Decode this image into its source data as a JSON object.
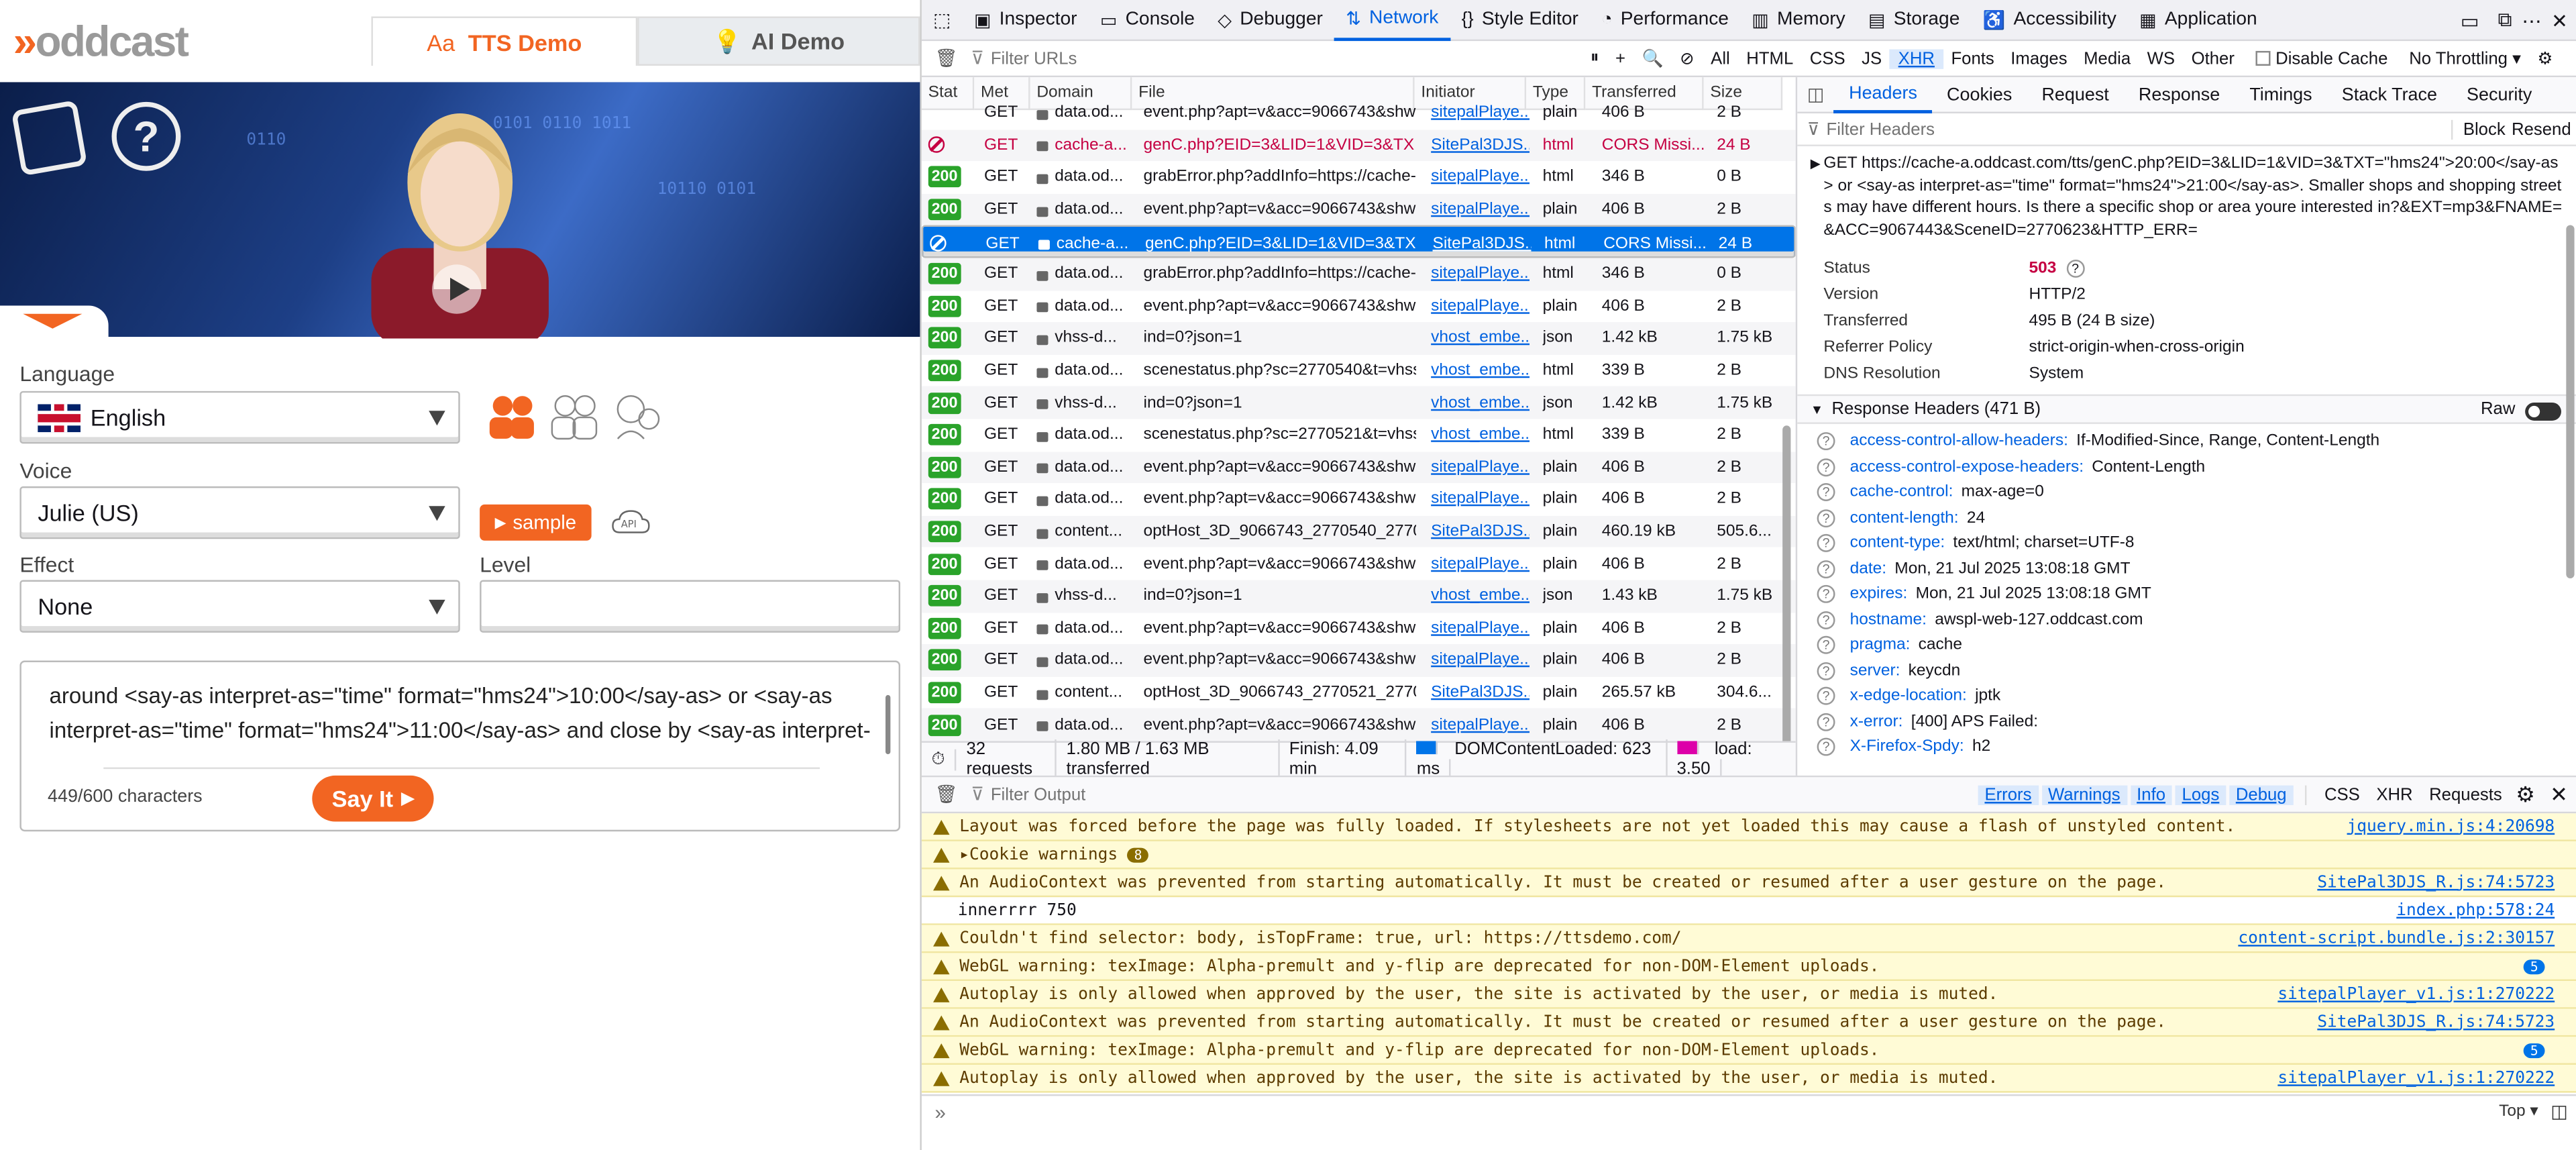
{
  "left": {
    "logo": "oddcast",
    "tabs": {
      "tts": "TTS Demo",
      "ai": "AI Demo"
    },
    "language_label": "Language",
    "language_value": "English",
    "voice_label": "Voice",
    "voice_value": "Julie (US)",
    "sample_label": "sample",
    "effect_label": "Effect",
    "effect_value": "None",
    "level_label": "Level",
    "textarea_text": "around <say-as interpret-as=\"time\" format=\"hms24\">10:00</say-as> or <say-as interpret-as=\"time\" format=\"hms24\">11:00</say-as> and close by <say-as interpret-",
    "char_count": "449/600 characters",
    "sayit_label": "Say It"
  },
  "devtools": {
    "tools": [
      "Inspector",
      "Console",
      "Debugger",
      "Network",
      "Style Editor",
      "Performance",
      "Memory",
      "Storage",
      "Accessibility",
      "Application"
    ],
    "active_tool": "Network",
    "filter_placeholder": "Filter URLs",
    "filter_types": [
      "All",
      "HTML",
      "CSS",
      "JS",
      "XHR",
      "Fonts",
      "Images",
      "Media",
      "WS",
      "Other"
    ],
    "active_filter": "XHR",
    "disable_cache": "Disable Cache",
    "throttle": "No Throttling",
    "columns": [
      "Stat",
      "Met",
      "Domain",
      "File",
      "Initiator",
      "Type",
      "Transferred",
      "Size"
    ],
    "requests": [
      {
        "status": "",
        "method": "GET",
        "domain": "data.od...",
        "file": "event.php?apt=v&acc=9066743&shw=2",
        "initiator": "sitepalPlaye...",
        "type": "plain",
        "transferred": "406 B",
        "size": "2 B",
        "kind": "ok",
        "partial": true
      },
      {
        "status": "",
        "method": "GET",
        "domain": "cache-a...",
        "file": "genC.php?EID=3&LID=1&VID=3&TX",
        "initiator": "SitePal3DJS...",
        "type": "html",
        "transferred": "CORS Missi...",
        "size": "24 B",
        "kind": "err"
      },
      {
        "status": "200",
        "method": "GET",
        "domain": "data.od...",
        "file": "grabError.php?addInfo=https://cache-a",
        "initiator": "sitepalPlaye...",
        "type": "html",
        "transferred": "346 B",
        "size": "0 B",
        "kind": "ok"
      },
      {
        "status": "200",
        "method": "GET",
        "domain": "data.od...",
        "file": "event.php?apt=v&acc=9066743&shw=2",
        "initiator": "sitepalPlaye...",
        "type": "plain",
        "transferred": "406 B",
        "size": "2 B",
        "kind": "ok"
      },
      {
        "status": "",
        "method": "GET",
        "domain": "cache-a...",
        "file": "genC.php?EID=3&LID=1&VID=3&TX",
        "initiator": "SitePal3DJS...",
        "type": "html",
        "transferred": "CORS Missi...",
        "size": "24 B",
        "kind": "sel"
      },
      {
        "status": "200",
        "method": "GET",
        "domain": "data.od...",
        "file": "grabError.php?addInfo=https://cache-a",
        "initiator": "sitepalPlaye...",
        "type": "html",
        "transferred": "346 B",
        "size": "0 B",
        "kind": "ok"
      },
      {
        "status": "200",
        "method": "GET",
        "domain": "data.od...",
        "file": "event.php?apt=v&acc=9066743&shw=2",
        "initiator": "sitepalPlaye...",
        "type": "plain",
        "transferred": "406 B",
        "size": "2 B",
        "kind": "ok"
      },
      {
        "status": "200",
        "method": "GET",
        "domain": "vhss-d...",
        "file": "ind=0?json=1",
        "initiator": "vhost_embe...",
        "type": "json",
        "transferred": "1.42 kB",
        "size": "1.75 kB",
        "kind": "ok"
      },
      {
        "status": "200",
        "method": "GET",
        "domain": "data.od...",
        "file": "scenestatus.php?sc=2770540&t=vhss&",
        "initiator": "vhost_embe...",
        "type": "html",
        "transferred": "339 B",
        "size": "2 B",
        "kind": "ok"
      },
      {
        "status": "200",
        "method": "GET",
        "domain": "vhss-d...",
        "file": "ind=0?json=1",
        "initiator": "vhost_embe...",
        "type": "json",
        "transferred": "1.42 kB",
        "size": "1.75 kB",
        "kind": "ok"
      },
      {
        "status": "200",
        "method": "GET",
        "domain": "data.od...",
        "file": "scenestatus.php?sc=2770521&t=vhss&",
        "initiator": "vhost_embe...",
        "type": "html",
        "transferred": "339 B",
        "size": "2 B",
        "kind": "ok"
      },
      {
        "status": "200",
        "method": "GET",
        "domain": "data.od...",
        "file": "event.php?apt=v&acc=9066743&shw=2",
        "initiator": "sitepalPlaye...",
        "type": "plain",
        "transferred": "406 B",
        "size": "2 B",
        "kind": "ok"
      },
      {
        "status": "200",
        "method": "GET",
        "domain": "data.od...",
        "file": "event.php?apt=v&acc=9066743&shw=2",
        "initiator": "sitepalPlaye...",
        "type": "plain",
        "transferred": "406 B",
        "size": "2 B",
        "kind": "ok"
      },
      {
        "status": "200",
        "method": "GET",
        "domain": "content...",
        "file": "optHost_3D_9066743_2770540_27705",
        "initiator": "SitePal3DJS...",
        "type": "plain",
        "transferred": "460.19 kB",
        "size": "505.6...",
        "kind": "ok"
      },
      {
        "status": "200",
        "method": "GET",
        "domain": "data.od...",
        "file": "event.php?apt=v&acc=9066743&shw=2",
        "initiator": "sitepalPlaye...",
        "type": "plain",
        "transferred": "406 B",
        "size": "2 B",
        "kind": "ok"
      },
      {
        "status": "200",
        "method": "GET",
        "domain": "vhss-d...",
        "file": "ind=0?json=1",
        "initiator": "vhost_embe...",
        "type": "json",
        "transferred": "1.43 kB",
        "size": "1.75 kB",
        "kind": "ok"
      },
      {
        "status": "200",
        "method": "GET",
        "domain": "data.od...",
        "file": "event.php?apt=v&acc=9066743&shw=2",
        "initiator": "sitepalPlaye...",
        "type": "plain",
        "transferred": "406 B",
        "size": "2 B",
        "kind": "ok"
      },
      {
        "status": "200",
        "method": "GET",
        "domain": "data.od...",
        "file": "event.php?apt=v&acc=9066743&shw=2",
        "initiator": "sitepalPlaye...",
        "type": "plain",
        "transferred": "406 B",
        "size": "2 B",
        "kind": "ok"
      },
      {
        "status": "200",
        "method": "GET",
        "domain": "content...",
        "file": "optHost_3D_9066743_2770521_27705",
        "initiator": "SitePal3DJS...",
        "type": "plain",
        "transferred": "265.57 kB",
        "size": "304.6...",
        "kind": "ok"
      },
      {
        "status": "200",
        "method": "GET",
        "domain": "data.od...",
        "file": "event.php?apt=v&acc=9066743&shw=2",
        "initiator": "sitepalPlaye...",
        "type": "plain",
        "transferred": "406 B",
        "size": "2 B",
        "kind": "ok"
      }
    ],
    "summary": {
      "requests": "32 requests",
      "transferred": "1.80 MB / 1.63 MB transferred",
      "finish": "Finish: 4.09 min",
      "dcl": "DOMContentLoaded: 623 ms",
      "load": "load: 3.50"
    },
    "detail_tabs": [
      "Headers",
      "Cookies",
      "Request",
      "Response",
      "Timings",
      "Stack Trace",
      "Security"
    ],
    "filter_headers": "Filter Headers",
    "block": "Block",
    "resend": "Resend",
    "request_line": "GET https://cache-a.oddcast.com/tts/genC.php?EID=3&LID=1&VID=3&TXT=\"hms24\">20:00</say-as> or <say-as interpret-as=\"time\" format=\"hms24\">21:00</say-as>. Smaller shops and shopping streets may have different hours. Is there a specific shop or area youre interested in?&EXT=mp3&FNAME=&ACC=9067443&SceneID=2770623&HTTP_ERR=",
    "summary_kv": [
      {
        "k": "Status",
        "v": "503"
      },
      {
        "k": "Version",
        "v": "HTTP/2"
      },
      {
        "k": "Transferred",
        "v": "495 B (24 B size)"
      },
      {
        "k": "Referrer Policy",
        "v": "strict-origin-when-cross-origin"
      },
      {
        "k": "DNS Resolution",
        "v": "System"
      }
    ],
    "response_headers_title": "Response Headers (471 B)",
    "raw_label": "Raw",
    "response_headers": [
      {
        "k": "access-control-allow-headers:",
        "v": "If-Modified-Since, Range, Content-Length"
      },
      {
        "k": "access-control-expose-headers:",
        "v": "Content-Length"
      },
      {
        "k": "cache-control:",
        "v": "max-age=0"
      },
      {
        "k": "content-length:",
        "v": "24"
      },
      {
        "k": "content-type:",
        "v": "text/html; charset=UTF-8"
      },
      {
        "k": "date:",
        "v": "Mon, 21 Jul 2025 13:08:18 GMT"
      },
      {
        "k": "expires:",
        "v": "Mon, 21 Jul 2025 13:08:18 GMT"
      },
      {
        "k": "hostname:",
        "v": "awspl-web-127.oddcast.com"
      },
      {
        "k": "pragma:",
        "v": "cache"
      },
      {
        "k": "server:",
        "v": "keycdn"
      },
      {
        "k": "x-edge-location:",
        "v": "jptk"
      },
      {
        "k": "x-error:",
        "v": "[400] APS Failed:"
      },
      {
        "k": "X-Firefox-Spdy:",
        "v": "h2"
      }
    ],
    "console_filter": "Filter Output",
    "console_levels": [
      "Errors",
      "Warnings",
      "Info",
      "Logs",
      "Debug"
    ],
    "console_extra": [
      "CSS",
      "XHR",
      "Requests"
    ],
    "console_msgs": [
      {
        "t": "Layout was forced before the page was fully loaded. If stylesheets are not yet loaded this may cause a flash of unstyled content.",
        "src": "jquery.min.js:4:20698",
        "kind": "warn"
      },
      {
        "t": "Cookie warnings",
        "src": "",
        "kind": "warn",
        "badge": "8"
      },
      {
        "t": "An AudioContext was prevented from starting automatically. It must be created or resumed after a user gesture on the page.",
        "src": "SitePal3DJS_R.js:74:5723",
        "kind": "warn"
      },
      {
        "t": "innerrrr 750",
        "src": "index.php:578:24",
        "kind": "log"
      },
      {
        "t": "Couldn't find selector: body, isTopFrame: true, url: https://ttsdemo.com/",
        "src": "content-script.bundle.js:2:30157",
        "kind": "warn"
      },
      {
        "t": "WebGL warning: texImage: Alpha-premult and y-flip are deprecated for non-DOM-Element uploads.",
        "src": "",
        "kind": "warn",
        "count": "5"
      },
      {
        "t": "Autoplay is only allowed when approved by the user, the site is activated by the user, or media is muted.",
        "src": "sitepalPlayer_v1.js:1:270222",
        "kind": "warn"
      },
      {
        "t": "An AudioContext was prevented from starting automatically. It must be created or resumed after a user gesture on the page.",
        "src": "SitePal3DJS_R.js:74:5723",
        "kind": "warn"
      },
      {
        "t": "WebGL warning: texImage: Alpha-premult and y-flip are deprecated for non-DOM-Element uploads.",
        "src": "",
        "kind": "warn",
        "count": "5"
      },
      {
        "t": "Autoplay is only allowed when approved by the user, the site is activated by the user, or media is muted.",
        "src": "sitepalPlayer_v1.js:1:270222",
        "kind": "warn"
      }
    ],
    "top_label": "Top"
  }
}
